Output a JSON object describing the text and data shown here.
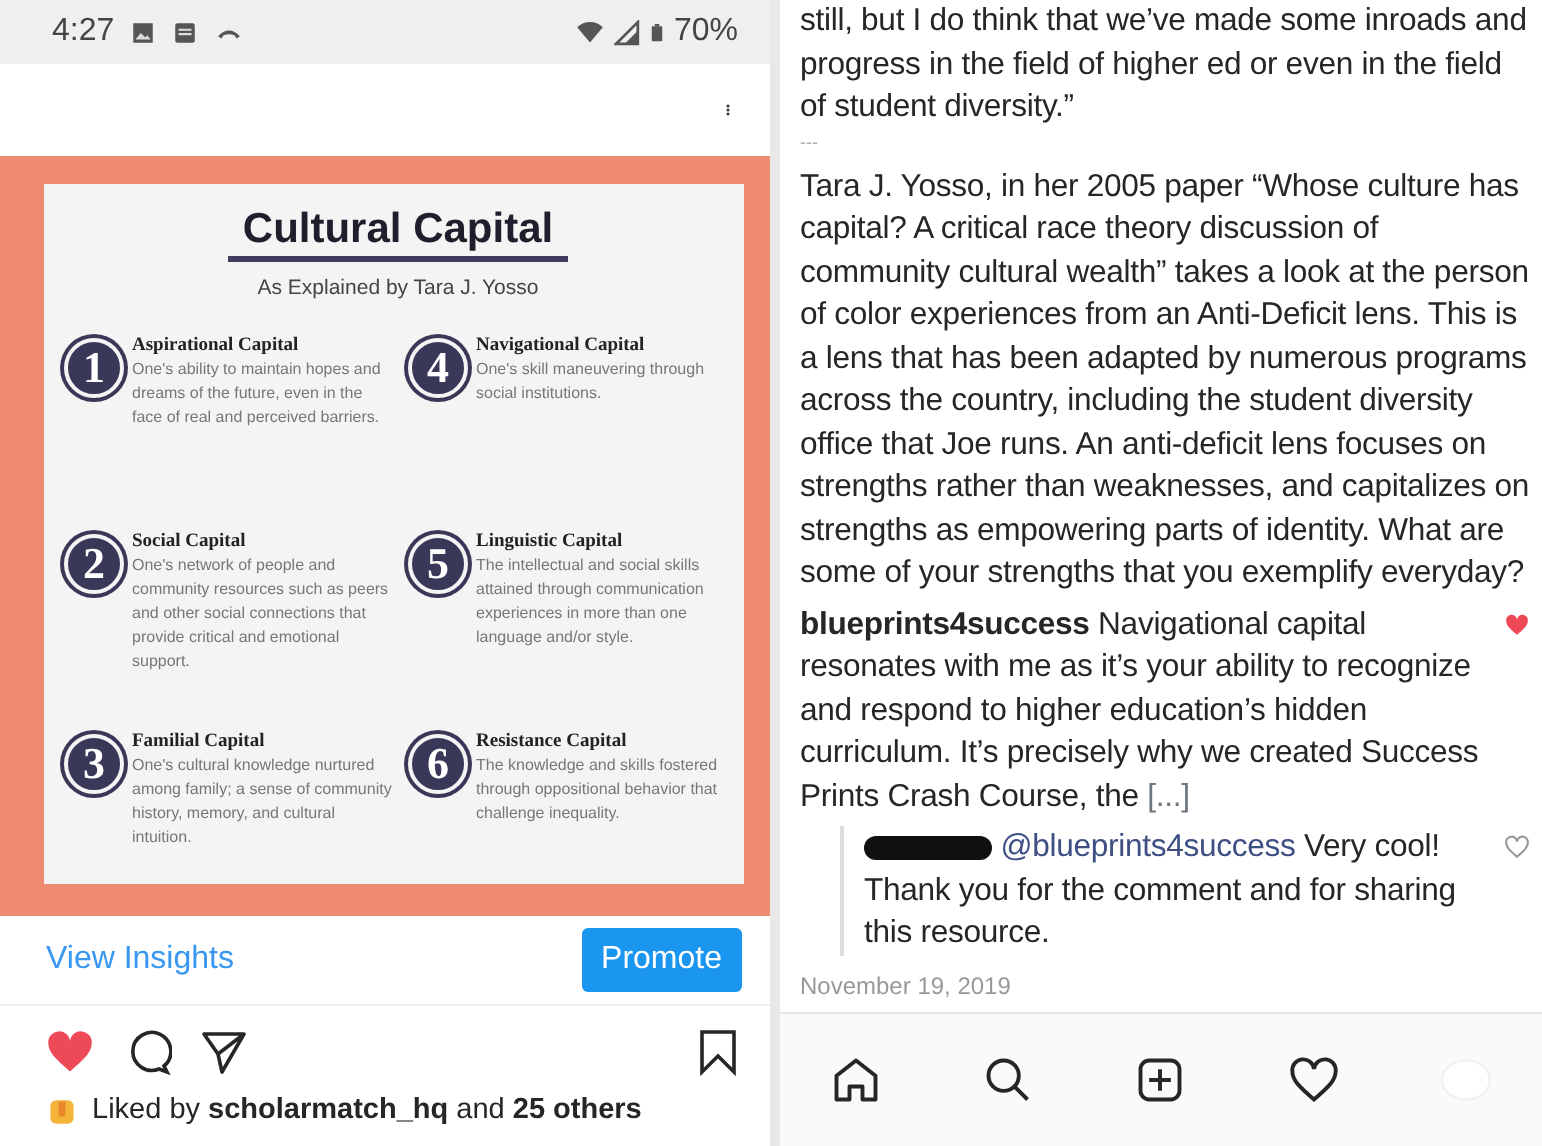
{
  "status_bar": {
    "time": "4:27",
    "battery": "70%"
  },
  "post_image": {
    "title": "Cultural Capital",
    "subtitle": "As Explained by Tara J. Yosso",
    "items": [
      {
        "number": "1",
        "heading": "Aspirational Capital",
        "body": "One's ability to maintain hopes and dreams of the future, even in the face of real and perceived barriers."
      },
      {
        "number": "2",
        "heading": "Social Capital",
        "body": "One's network of people and community resources such as peers and other social connections that provide critical and emotional support."
      },
      {
        "number": "3",
        "heading": "Familial Capital",
        "body": "One's cultural knowledge nurtured among family; a sense of community history, memory, and cultural intuition."
      },
      {
        "number": "4",
        "heading": "Navigational Capital",
        "body": "One's skill maneuvering through social institutions."
      },
      {
        "number": "5",
        "heading": "Linguistic Capital",
        "body": "The intellectual and social skills attained through communication experiences in more than one language and/or style."
      },
      {
        "number": "6",
        "heading": "Resistance Capital",
        "body": "The knowledge and skills fostered through oppositional behavior that challenge inequality."
      }
    ]
  },
  "insights_link": "View Insights",
  "promote_button": "Promote",
  "actions": {
    "liked": true,
    "saved": false
  },
  "likes": "Liked by **scholarmatch_hq** and **25 others**",
  "caption": [
    "still, but I do think that we’ve made some inroads and progress in the field of higher ed or even in the field of student diversity.”",
    "---",
    "Tara J. Yosso, in her 2005 paper “Whose culture has capital? A critical race theory discussion of community cultural wealth” takes a look at the person of color experiences from an Anti-Deficit lens. This is a lens that has been adapted by numerous programs across the country, including the student diversity office that Joe runs. An anti-deficit lens focuses on strengths rather than weaknesses, and capitalizes on strengths as empowering parts of identity. What are some of your strengths that you exemplify everyday?"
  ],
  "comments": [
    {
      "kind": "comment",
      "username": "blueprints4success",
      "text": "Navigational capital resonates with me as it’s your ability to recognize and respond to higher education’s hidden curriculum. It’s precisely why we created Success Prints Crash Course, the",
      "more": "[...]",
      "liked": true
    },
    {
      "kind": "reply",
      "mention": "@blueprints4success",
      "text": "Very cool! Thank you for the comment and for sharing this resource.",
      "liked": false
    }
  ],
  "date": "November 19, 2019",
  "bottom_nav": [
    {
      "kind": "home"
    },
    {
      "kind": "search"
    },
    {
      "kind": "add"
    },
    {
      "kind": "activity"
    },
    {
      "kind": "profile"
    }
  ]
}
